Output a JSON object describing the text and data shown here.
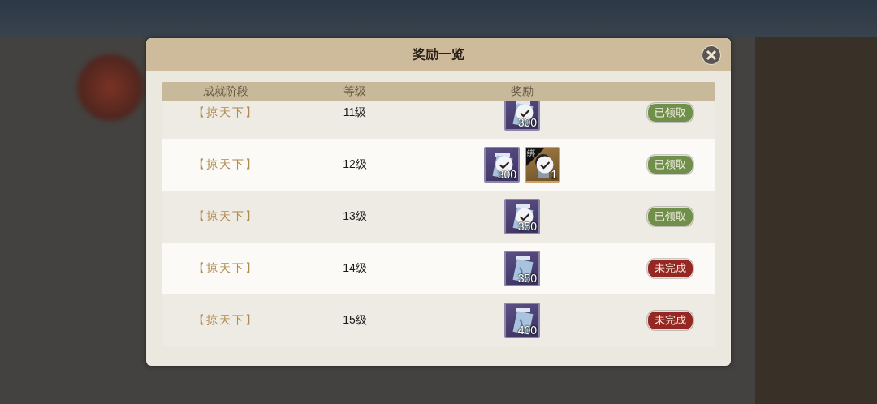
{
  "dialog": {
    "title": "奖励一览",
    "columns": [
      "成就阶段",
      "等级",
      "奖励"
    ],
    "rows": [
      {
        "stage": "【掠天下】",
        "level": "11级",
        "rewards": [
          {
            "kind": "scroll",
            "count": "300",
            "claimed": true
          }
        ],
        "status": {
          "kind": "claimed",
          "label": "已领取"
        }
      },
      {
        "stage": "【掠天下】",
        "level": "12级",
        "rewards": [
          {
            "kind": "scroll",
            "count": "300",
            "claimed": true
          },
          {
            "kind": "token",
            "tag": "绑",
            "count": "1",
            "claimed": true
          }
        ],
        "status": {
          "kind": "claimed",
          "label": "已领取"
        }
      },
      {
        "stage": "【掠天下】",
        "level": "13级",
        "rewards": [
          {
            "kind": "scroll",
            "count": "350",
            "claimed": true
          }
        ],
        "status": {
          "kind": "claimed",
          "label": "已领取"
        }
      },
      {
        "stage": "【掠天下】",
        "level": "14级",
        "rewards": [
          {
            "kind": "scroll",
            "count": "350",
            "claimed": false
          }
        ],
        "status": {
          "kind": "incomplete",
          "label": "未完成"
        }
      },
      {
        "stage": "【掠天下】",
        "level": "15级",
        "rewards": [
          {
            "kind": "scroll",
            "count": "400",
            "claimed": false
          }
        ],
        "status": {
          "kind": "incomplete",
          "label": "未完成"
        }
      }
    ]
  }
}
